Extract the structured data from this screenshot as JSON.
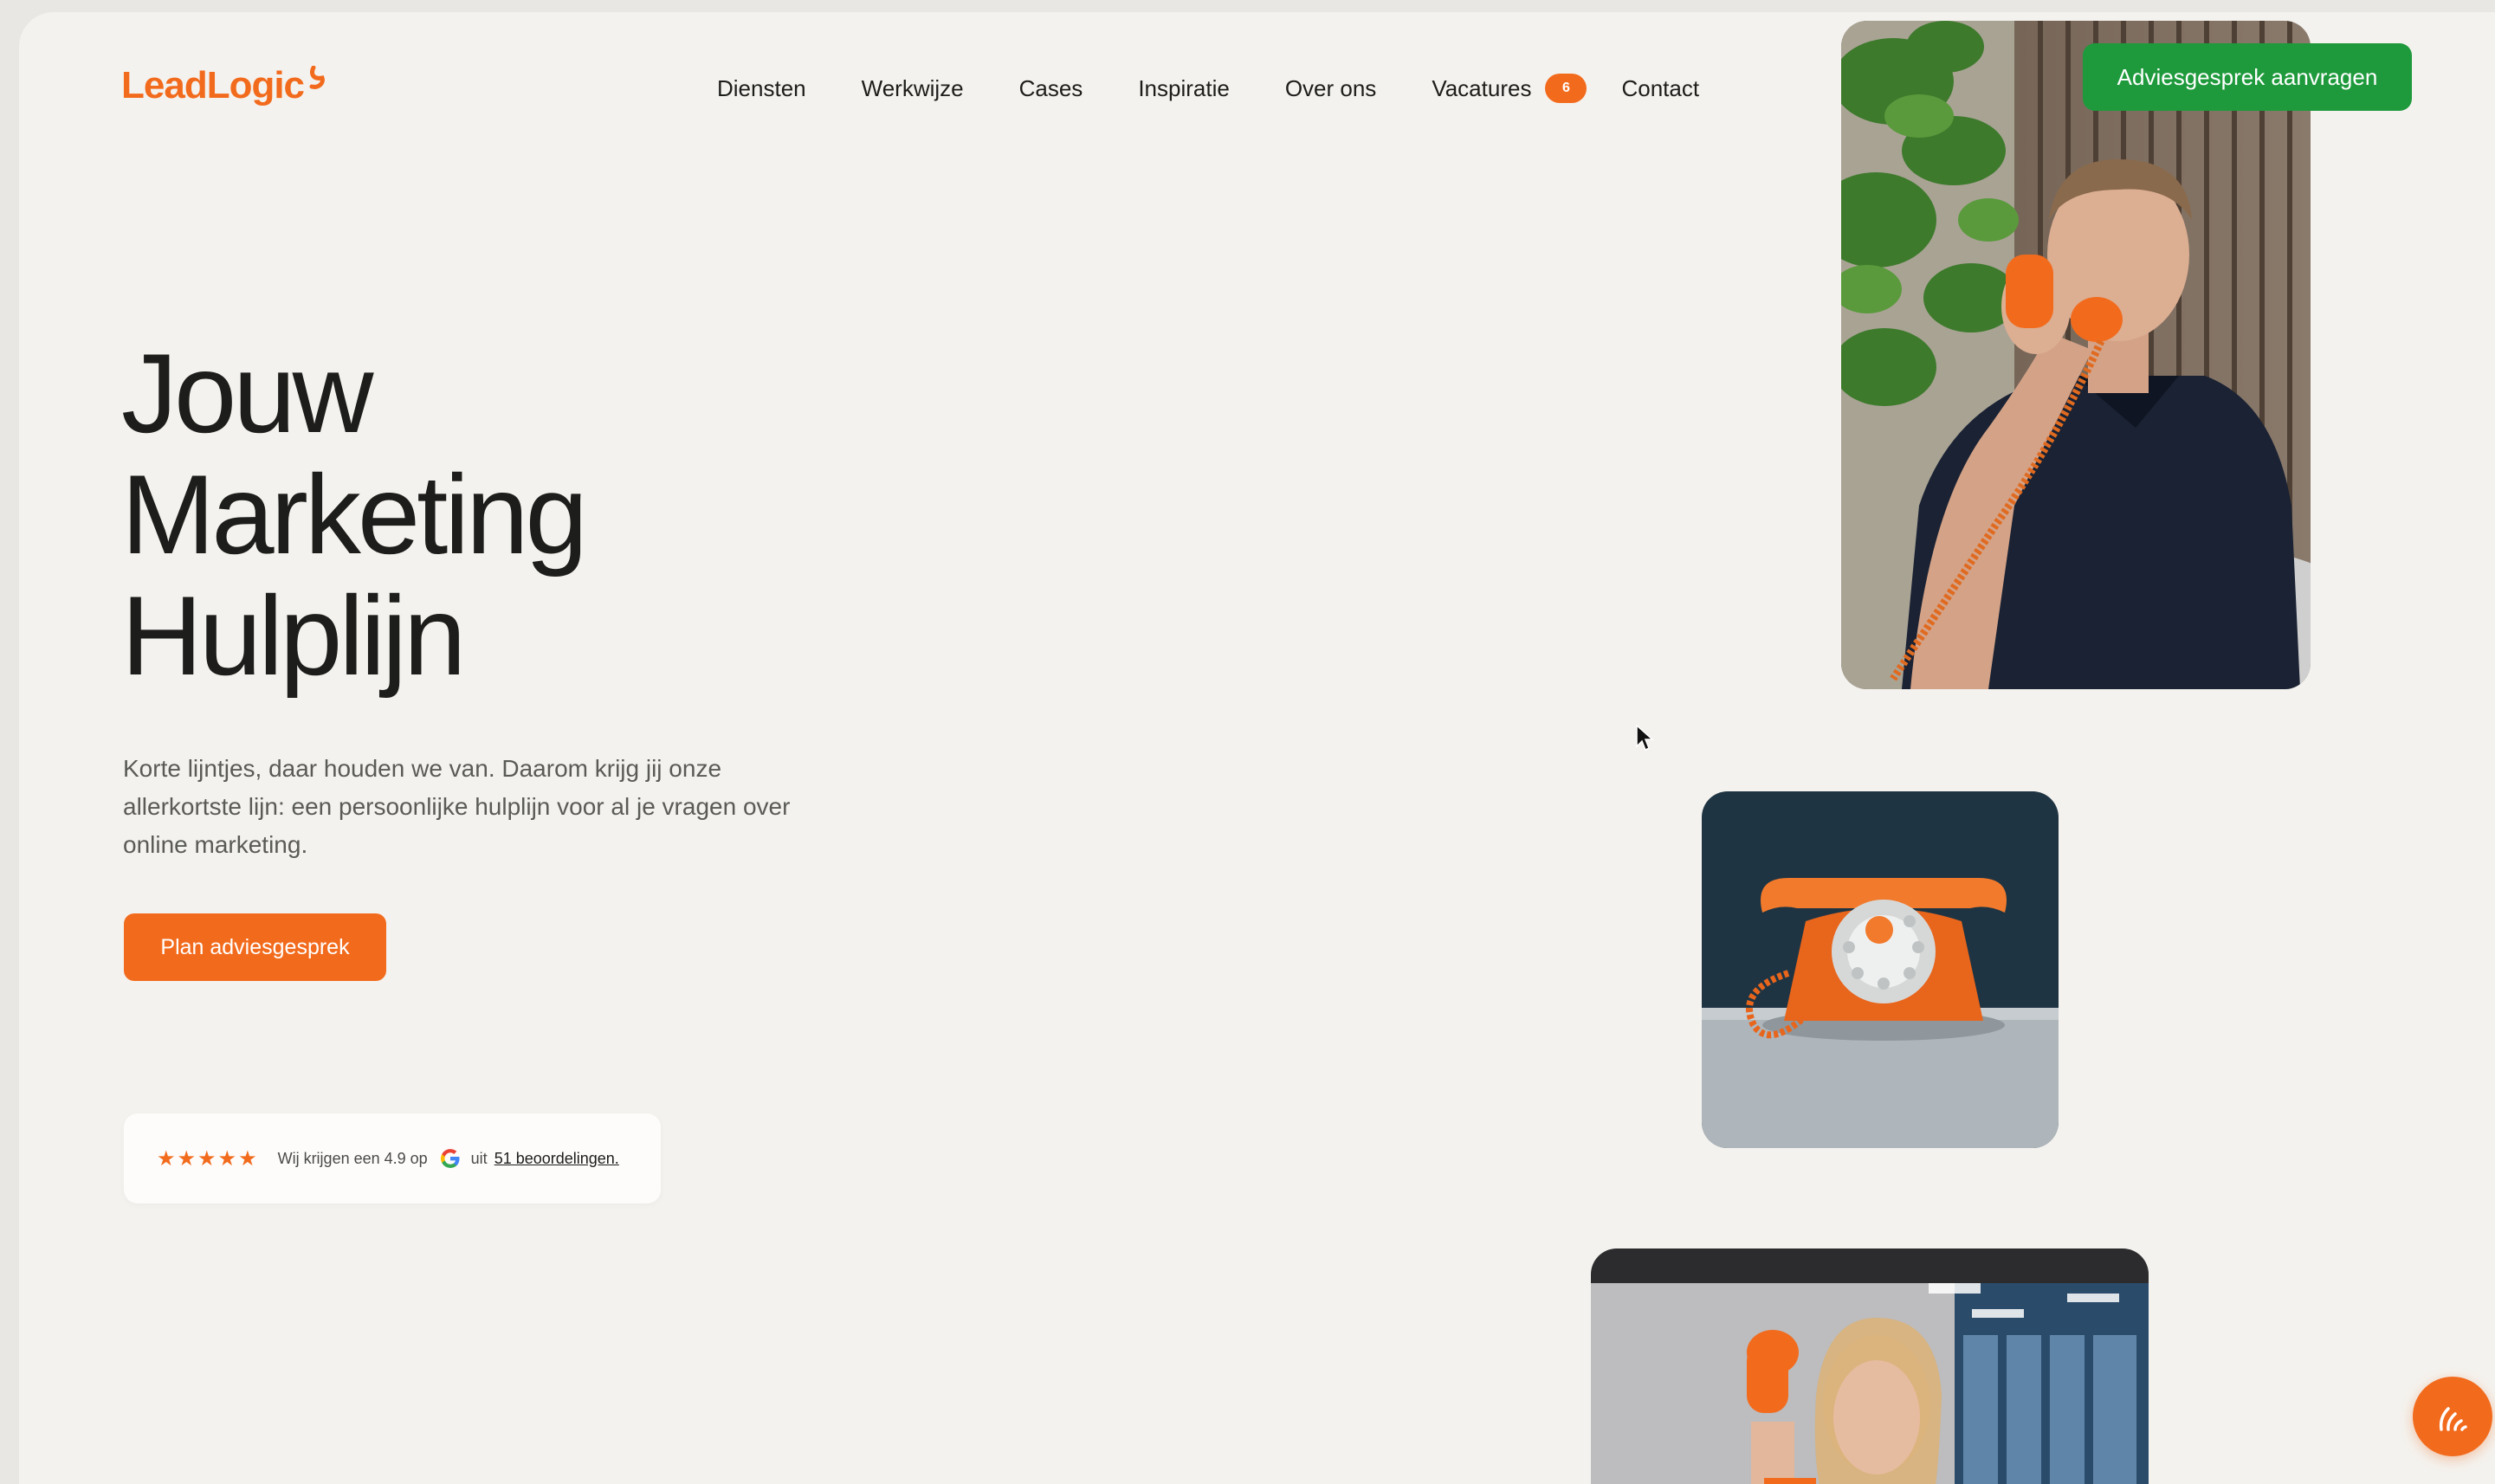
{
  "brand": {
    "name": "LeadLogic",
    "color": "#f26b1d"
  },
  "nav": {
    "items": [
      {
        "label": "Diensten"
      },
      {
        "label": "Werkwijze"
      },
      {
        "label": "Cases"
      },
      {
        "label": "Inspiratie"
      },
      {
        "label": "Over ons"
      },
      {
        "label": "Vacatures",
        "badge": "6"
      },
      {
        "label": "Contact"
      }
    ],
    "cta_label": "Adviesgesprek aanvragen"
  },
  "hero": {
    "title_lines": [
      "Jouw",
      "Marketing",
      "Hulplijn"
    ],
    "text": "Korte lijntjes, daar houden we van. Daarom krijg jij onze allerkortste lijn: een persoonlijke hulplijn voor al je vragen over online marketing.",
    "button_label": "Plan adviesgesprek"
  },
  "review": {
    "stars": "★★★★★",
    "rating_text": "Wij krijgen een 4.9 op",
    "platform_icon": "google-icon",
    "uit": "uit",
    "count_link": "51 beoordelingen."
  },
  "icons": {
    "chat": "chat-icon",
    "cursor": "mouse-cursor-icon"
  },
  "colors": {
    "accent": "#f26b1d",
    "cta_green": "#1e9a3c",
    "background": "#f4f2ee"
  }
}
